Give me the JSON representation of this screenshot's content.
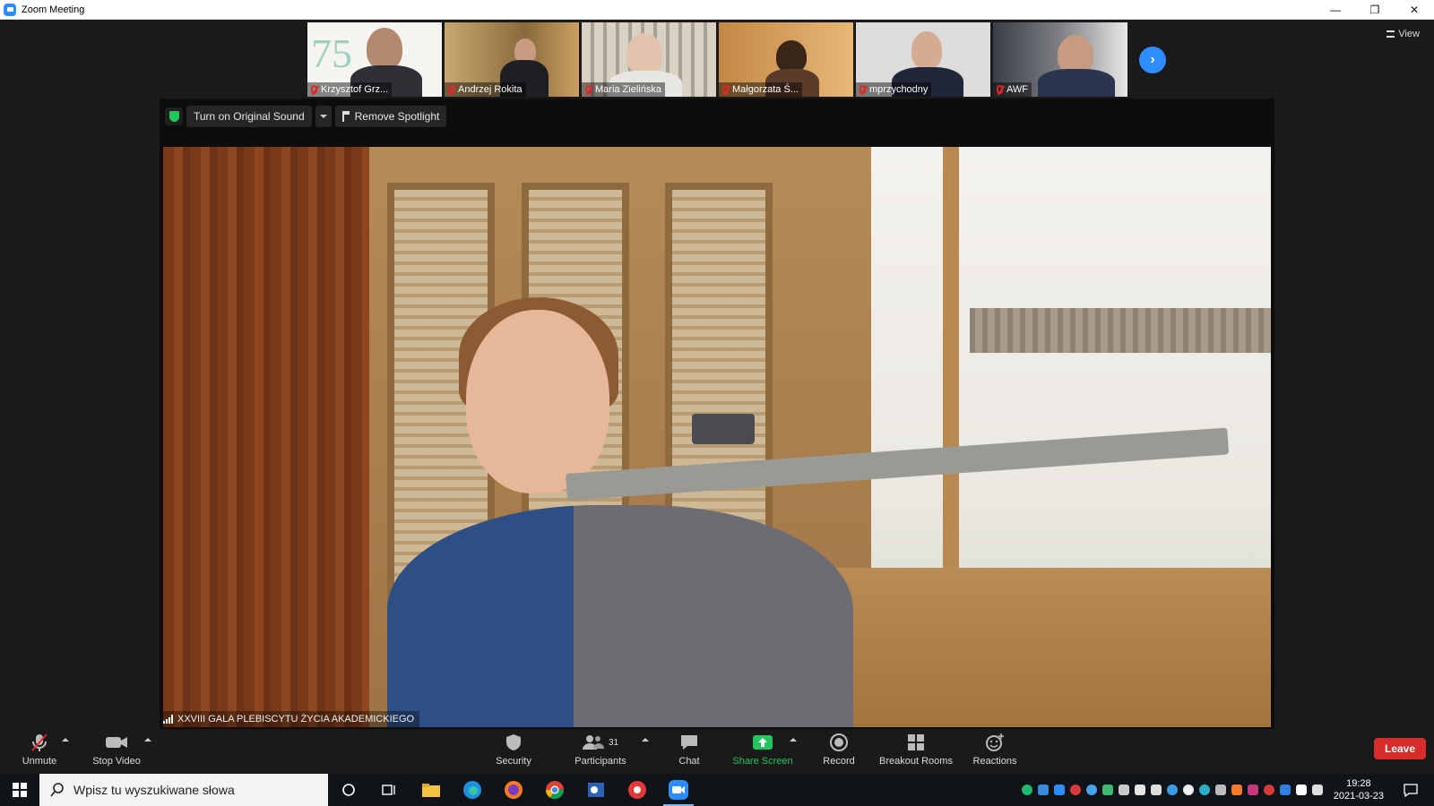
{
  "window": {
    "title": "Zoom Meeting"
  },
  "view_button": {
    "label": "View"
  },
  "participants_strip": [
    {
      "name": "Krzysztof Grz...",
      "bg": "#f4f4f0"
    },
    {
      "name": "Andrzej Rokita",
      "bg": "#a88152"
    },
    {
      "name": "Maria Zielińska",
      "bg": "#cfc5b5"
    },
    {
      "name": "Małgorzata Ś...",
      "bg": "#d7a25d"
    },
    {
      "name": "mprzychodny",
      "bg": "#d9d9d9"
    },
    {
      "name": "AWF",
      "bg": "#6b6f74"
    }
  ],
  "stage": {
    "original_sound_label": "Turn on Original Sound",
    "remove_spotlight_label": "Remove Spotlight",
    "speaker_caption": "XXVIII GALA PLEBISCYTU ŻYCIA AKADEMICKIEGO"
  },
  "controls": {
    "unmute": "Unmute",
    "stop_video": "Stop Video",
    "security": "Security",
    "participants": "Participants",
    "participants_count": "31",
    "chat": "Chat",
    "share_screen": "Share Screen",
    "record": "Record",
    "breakout_rooms": "Breakout Rooms",
    "reactions": "Reactions",
    "leave": "Leave"
  },
  "taskbar": {
    "search_placeholder": "Wpisz tu wyszukiwane słowa",
    "time": "19:28",
    "date": "2021-03-23"
  },
  "colors": {
    "accent": "#2d8cff",
    "share_green": "#22c55e",
    "leave_red": "#d82c2c",
    "muted_red": "#e02828"
  },
  "icons": {
    "app": "zoom-logo-icon",
    "next": "chevron-right-icon",
    "security": "shield-icon",
    "mic": "microphone-muted-icon",
    "video": "camera-icon"
  }
}
